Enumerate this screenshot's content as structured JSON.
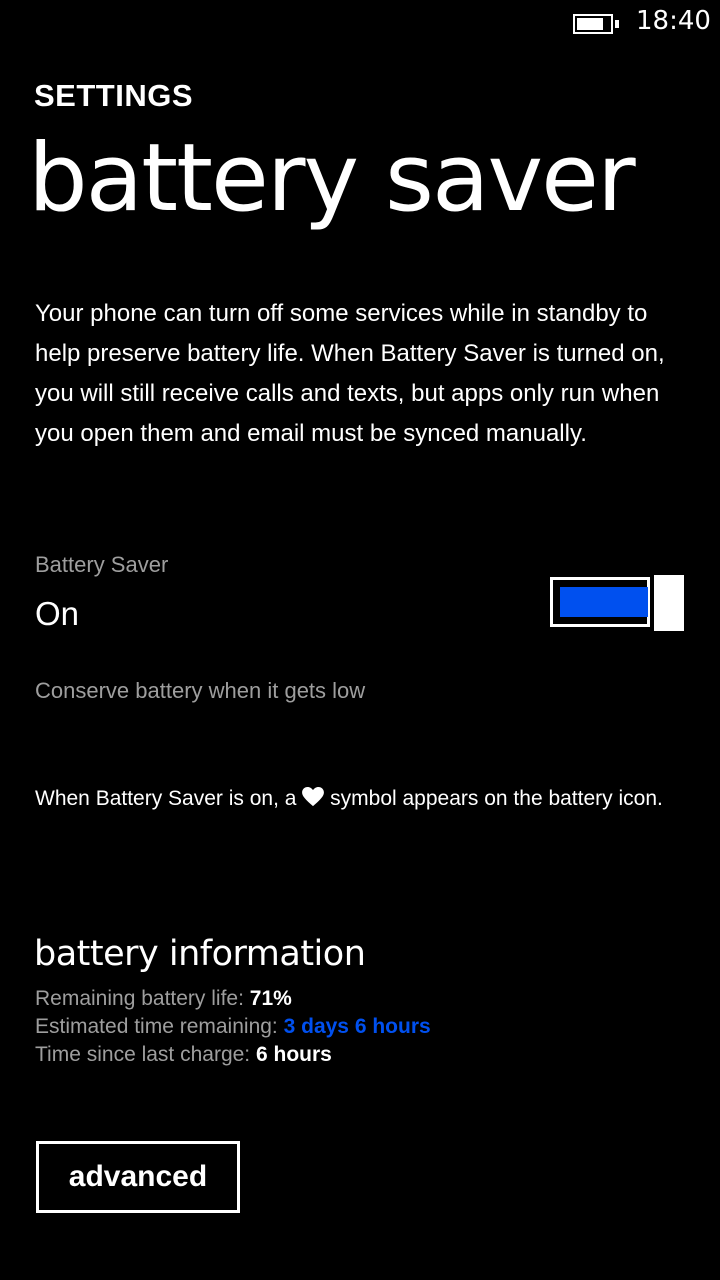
{
  "status_bar": {
    "battery_icon": "battery-icon",
    "time": "18:40"
  },
  "header": {
    "app_title": "SETTINGS",
    "page_title": "battery saver"
  },
  "description": "Your phone can turn off some services while in standby to help preserve battery life. When Battery Saver is turned on, you will still receive calls and texts, but apps only run when you open them and email must be synced manually.",
  "battery_saver_toggle": {
    "header": "Battery Saver",
    "state": "On",
    "is_on": true,
    "caption": "Conserve battery when it gets low"
  },
  "note": {
    "before_icon": "When Battery Saver is on, a",
    "icon": "heart-icon",
    "after_icon": "symbol appears on the battery icon."
  },
  "battery_information": {
    "heading": "battery information",
    "rows": [
      {
        "label": "Remaining battery life:",
        "value": "71%"
      },
      {
        "label": "Estimated time remaining:",
        "value": "3 days 6 hours"
      },
      {
        "label": "Time since last charge:",
        "value": "6 hours"
      }
    ]
  },
  "advanced_button_label": "advanced",
  "colors": {
    "background": "#000000",
    "accent": "#0050ef",
    "secondary_text": "#9e9e9e",
    "foreground": "#ffffff"
  }
}
